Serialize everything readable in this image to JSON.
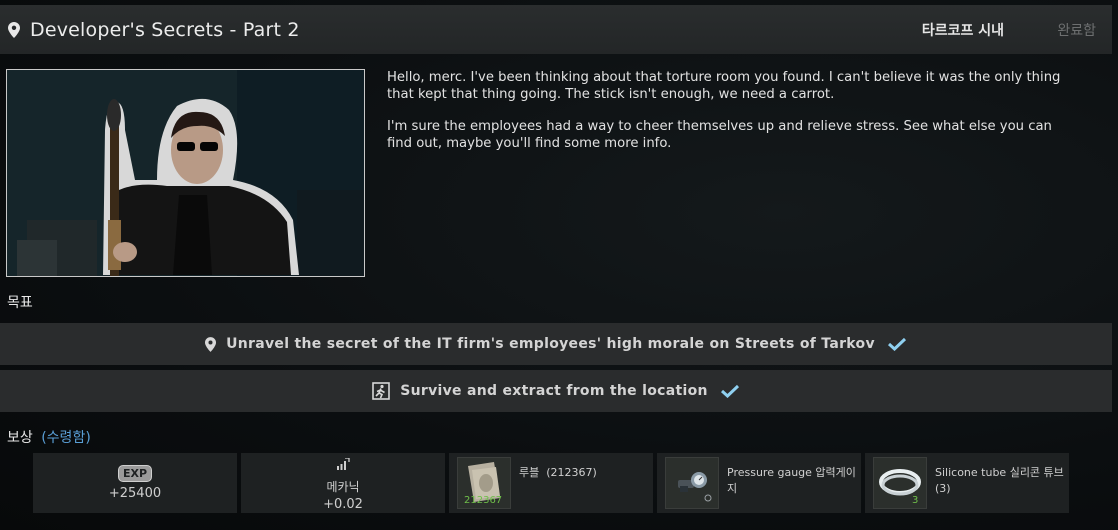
{
  "header": {
    "title": "Developer's Secrets - Part 2",
    "location": "타르코프 시내",
    "status": "완료함"
  },
  "description": {
    "paragraphs": [
      "Hello, merc. I've been thinking about that torture room you found. I can't believe it was the only thing that kept that thing going. The stick isn't enough, we need a carrot.",
      "I'm sure the employees had a way to cheer themselves up and relieve stress. See what else you can find out, maybe you'll find some more info."
    ]
  },
  "objectives": {
    "label": "목표",
    "items": [
      {
        "text": "Unravel the secret of the IT firm's employees' high morale on Streets of Tarkov",
        "icon": "location-pin-icon",
        "completed": true
      },
      {
        "text": "Survive and extract from the location",
        "icon": "exit-icon",
        "completed": true
      }
    ]
  },
  "rewards": {
    "label": "보상",
    "claimed_label": "(수령함)",
    "exp": {
      "badge": "EXP",
      "value": "+25400"
    },
    "standing": {
      "trader": "메카닉",
      "value": "+0.02"
    },
    "items": [
      {
        "name": "루블",
        "detail": "(212367)",
        "count": "212367",
        "icon": "roubles-icon"
      },
      {
        "name": "Pressure gauge 압력게이지",
        "detail": "",
        "count": "",
        "icon": "pressure-gauge-icon"
      },
      {
        "name": "Silicone tube 실리콘 튜브",
        "detail": "(3)",
        "count": "3",
        "icon": "silicone-tube-icon"
      }
    ]
  },
  "colors": {
    "accent_check": "#8fd0f0",
    "claimed": "#5a9fd6",
    "count_green": "#6fbf4a"
  }
}
